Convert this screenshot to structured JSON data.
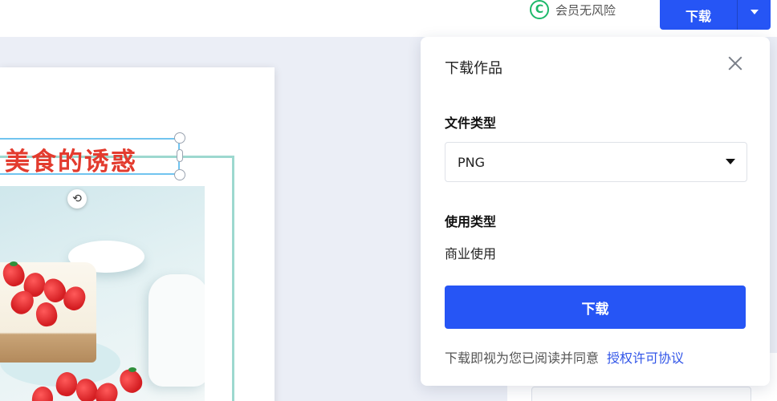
{
  "topbar": {
    "vip_icon": "C",
    "vip_label": "会员无风险",
    "download_label": "下载",
    "download_dropdown_icon": "caret-down-icon"
  },
  "canvas": {
    "headline": "美食的诱惑",
    "rotate_icon": "⟲"
  },
  "panel": {
    "title": "下载作品",
    "close_icon": "close-icon",
    "file_type_label": "文件类型",
    "file_type_value": "PNG",
    "usage_type_label": "使用类型",
    "usage_type_value": "商业使用",
    "download_button": "下载",
    "agreement_text": "下载即视为您已阅读并同意",
    "agreement_link": "授权许可协议"
  },
  "colors": {
    "accent": "#2655f5",
    "headline": "#e33b2e",
    "vip_green": "#1db86a"
  }
}
